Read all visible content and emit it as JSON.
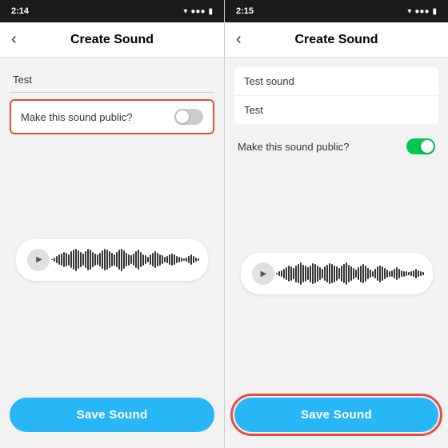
{
  "phone1": {
    "statusBar": {
      "time": "2:14",
      "wifi": "▲",
      "battery": "■"
    },
    "header": {
      "backLabel": "‹",
      "title": "Create Sound"
    },
    "form": {
      "nameValue": "Test",
      "toggleLabel": "Make this sound public?",
      "toggleState": "off"
    },
    "waveform": {
      "bars": [
        2,
        6,
        10,
        14,
        18,
        22,
        20,
        16,
        24,
        28,
        32,
        26,
        22,
        18,
        24,
        30,
        28,
        22,
        18,
        14,
        20,
        26,
        30,
        28,
        24,
        20,
        16,
        22,
        28,
        32,
        26,
        20,
        16,
        12,
        18,
        24,
        28,
        22,
        16,
        12,
        8,
        14,
        20,
        24,
        20,
        16,
        12,
        8,
        10,
        14,
        18,
        14,
        10,
        8,
        6,
        4,
        6,
        10,
        14,
        10,
        6,
        4
      ]
    },
    "saveButton": {
      "label": "Save Sound",
      "highlighted": false
    }
  },
  "phone2": {
    "statusBar": {
      "time": "2:15",
      "wifi": "▲",
      "battery": "■"
    },
    "header": {
      "backLabel": "‹",
      "title": "Create Sound"
    },
    "form": {
      "nameValue": "Test sound",
      "descValue": "Test",
      "toggleLabel": "Make this sound public?",
      "toggleState": "on"
    },
    "waveform": {
      "bars": [
        2,
        6,
        10,
        14,
        18,
        22,
        20,
        16,
        24,
        28,
        32,
        26,
        22,
        18,
        24,
        30,
        28,
        22,
        18,
        14,
        20,
        26,
        30,
        28,
        24,
        20,
        16,
        22,
        28,
        32,
        26,
        20,
        16,
        12,
        18,
        24,
        28,
        22,
        16,
        12,
        8,
        14,
        20,
        24,
        20,
        16,
        12,
        8,
        10,
        14,
        18,
        14,
        10,
        8,
        6,
        4,
        6,
        10,
        14,
        10,
        6,
        4
      ]
    },
    "saveButton": {
      "label": "Save Sound",
      "highlighted": true
    }
  }
}
